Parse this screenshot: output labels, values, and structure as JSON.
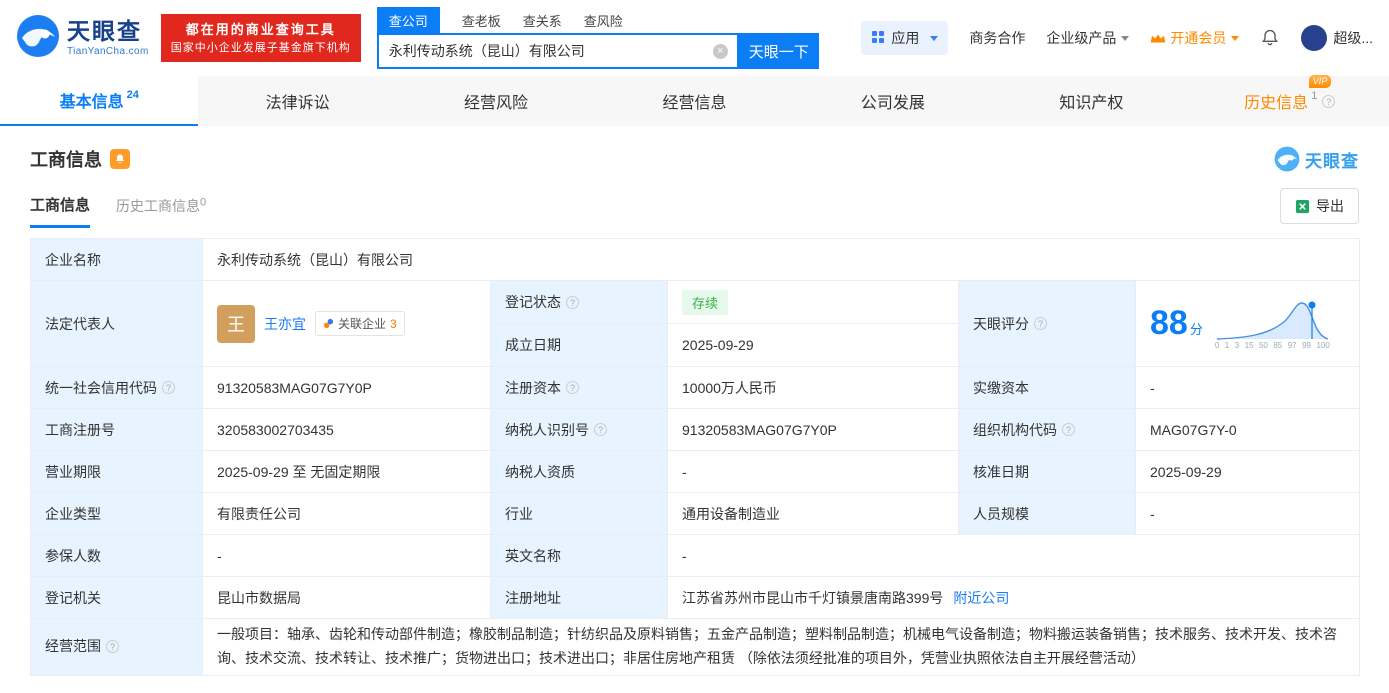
{
  "header": {
    "brand": "天眼查",
    "brand_domain": "TianYanCha.com",
    "slogan_line1": "都在用的商业查询工具",
    "slogan_line2": "国家中小企业发展子基金旗下机构",
    "search_tabs": [
      {
        "label": "查公司"
      },
      {
        "label": "查老板"
      },
      {
        "label": "查关系"
      },
      {
        "label": "查风险"
      }
    ],
    "search_value": "永利传动系统（昆山）有限公司",
    "search_button": "天眼一下",
    "apps_label": "应用",
    "biz_label": "商务合作",
    "enterprise_label": "企业级产品",
    "vip_label": "开通会员",
    "user_label": "超级..."
  },
  "nav_tabs": [
    {
      "label": "基本信息",
      "count": "24"
    },
    {
      "label": "法律诉讼"
    },
    {
      "label": "经营风险"
    },
    {
      "label": "经营信息"
    },
    {
      "label": "公司发展"
    },
    {
      "label": "知识产权"
    },
    {
      "label": "历史信息",
      "count": "1",
      "vip": "VIP"
    }
  ],
  "section": {
    "title": "工商信息",
    "subtab_active": "工商信息",
    "subtab_history_label": "历史工商信息",
    "subtab_history_count": "0",
    "export": "导出",
    "watermark_brand": "天眼查"
  },
  "info": {
    "name_label": "企业名称",
    "name": "永利传动系统（昆山）有限公司",
    "legal_label": "法定代表人",
    "legal_avatar": "王",
    "legal_name": "王亦宜",
    "related_label": "关联企业",
    "related_count": "3",
    "status_label": "登记状态",
    "status": "存续",
    "founded_label": "成立日期",
    "founded": "2025-09-29",
    "score_label": "天眼评分",
    "score": "88",
    "score_unit": "分",
    "score_axis": [
      "0",
      "1",
      "3",
      "15",
      "50",
      "85",
      "97",
      "99",
      "100"
    ],
    "credit_code_label": "统一社会信用代码",
    "credit_code": "91320583MAG07G7Y0P",
    "reg_capital_label": "注册资本",
    "reg_capital": "10000万人民币",
    "paid_capital_label": "实缴资本",
    "paid_capital": "-",
    "reg_no_label": "工商注册号",
    "reg_no": "320583002703435",
    "tax_id_label": "纳税人识别号",
    "tax_id": "91320583MAG07G7Y0P",
    "org_code_label": "组织机构代码",
    "org_code": "MAG07G7Y-0",
    "term_label": "营业期限",
    "term": "2025-09-29 至 无固定期限",
    "tax_quality_label": "纳税人资质",
    "tax_quality": "-",
    "approve_date_label": "核准日期",
    "approve_date": "2025-09-29",
    "type_label": "企业类型",
    "type": "有限责任公司",
    "industry_label": "行业",
    "industry": "通用设备制造业",
    "staff_label": "人员规模",
    "staff": "-",
    "insured_label": "参保人数",
    "insured": "-",
    "en_name_label": "英文名称",
    "en_name": "-",
    "authority_label": "登记机关",
    "authority": "昆山市数据局",
    "address_label": "注册地址",
    "address": "江苏省苏州市昆山市千灯镇景唐南路399号",
    "nearby": "附近公司",
    "scope_label": "经营范围",
    "scope": "一般项目：轴承、齿轮和传动部件制造；橡胶制品制造；针纺织品及原料销售；五金产品制造；塑料制品制造；机械电气设备制造；物料搬运装备销售；技术服务、技术开发、技术咨询、技术交流、技术转让、技术推广；货物进出口；技术进出口；非居住房地产租赁 （除依法须经批准的项目外，凭营业执照依法自主开展经营活动）"
  }
}
